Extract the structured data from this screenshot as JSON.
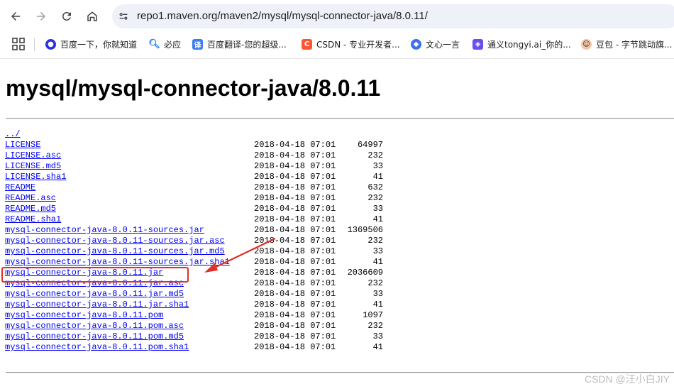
{
  "browser": {
    "address": "repo1.maven.org/maven2/mysql/mysql-connector-java/8.0.11/",
    "bookmarks": [
      {
        "label": "百度一下，你就知道",
        "icon": "baidu-paw-icon",
        "color": "#2932e1"
      },
      {
        "label": "必应",
        "icon": "bing-search-icon",
        "color": "#1a73e8"
      },
      {
        "label": "百度翻译-您的超级...",
        "icon": "translate-icon",
        "color": "#3a7cf3"
      },
      {
        "label": "CSDN - 专业开发者...",
        "icon": "csdn-icon",
        "color": "#fc5531"
      },
      {
        "label": "文心一言",
        "icon": "wenxin-icon",
        "color": "#3a6ff0"
      },
      {
        "label": "通义tongyi.ai_你的...",
        "icon": "tongyi-icon",
        "color": "#6a4cf0"
      },
      {
        "label": "豆包 - 字节跳动旗...",
        "icon": "doubao-icon",
        "color": "#f2c3a5"
      }
    ]
  },
  "page": {
    "title": "mysql/mysql-connector-java/8.0.11",
    "parent_link": "../",
    "files": [
      {
        "name": "LICENSE",
        "date": "2018-04-18 07:01",
        "size": "64997"
      },
      {
        "name": "LICENSE.asc",
        "date": "2018-04-18 07:01",
        "size": "232"
      },
      {
        "name": "LICENSE.md5",
        "date": "2018-04-18 07:01",
        "size": "33"
      },
      {
        "name": "LICENSE.sha1",
        "date": "2018-04-18 07:01",
        "size": "41"
      },
      {
        "name": "README",
        "date": "2018-04-18 07:01",
        "size": "632"
      },
      {
        "name": "README.asc",
        "date": "2018-04-18 07:01",
        "size": "232"
      },
      {
        "name": "README.md5",
        "date": "2018-04-18 07:01",
        "size": "33"
      },
      {
        "name": "README.sha1",
        "date": "2018-04-18 07:01",
        "size": "41"
      },
      {
        "name": "mysql-connector-java-8.0.11-sources.jar",
        "date": "2018-04-18 07:01",
        "size": "1369506"
      },
      {
        "name": "mysql-connector-java-8.0.11-sources.jar.asc",
        "date": "2018-04-18 07:01",
        "size": "232"
      },
      {
        "name": "mysql-connector-java-8.0.11-sources.jar.md5",
        "date": "2018-04-18 07:01",
        "size": "33"
      },
      {
        "name": "mysql-connector-java-8.0.11-sources.jar.sha1",
        "date": "2018-04-18 07:01",
        "size": "41"
      },
      {
        "name": "mysql-connector-java-8.0.11.jar",
        "date": "2018-04-18 07:01",
        "size": "2036609"
      },
      {
        "name": "mysql-connector-java-8.0.11.jar.asc",
        "date": "2018-04-18 07:01",
        "size": "232"
      },
      {
        "name": "mysql-connector-java-8.0.11.jar.md5",
        "date": "2018-04-18 07:01",
        "size": "33"
      },
      {
        "name": "mysql-connector-java-8.0.11.jar.sha1",
        "date": "2018-04-18 07:01",
        "size": "41"
      },
      {
        "name": "mysql-connector-java-8.0.11.pom",
        "date": "2018-04-18 07:01",
        "size": "1097"
      },
      {
        "name": "mysql-connector-java-8.0.11.pom.asc",
        "date": "2018-04-18 07:01",
        "size": "232"
      },
      {
        "name": "mysql-connector-java-8.0.11.pom.md5",
        "date": "2018-04-18 07:01",
        "size": "33"
      },
      {
        "name": "mysql-connector-java-8.0.11.pom.sha1",
        "date": "2018-04-18 07:01",
        "size": "41"
      }
    ],
    "annotation_color": "#e0302a"
  },
  "watermark": "CSDN @汪小白JIY"
}
